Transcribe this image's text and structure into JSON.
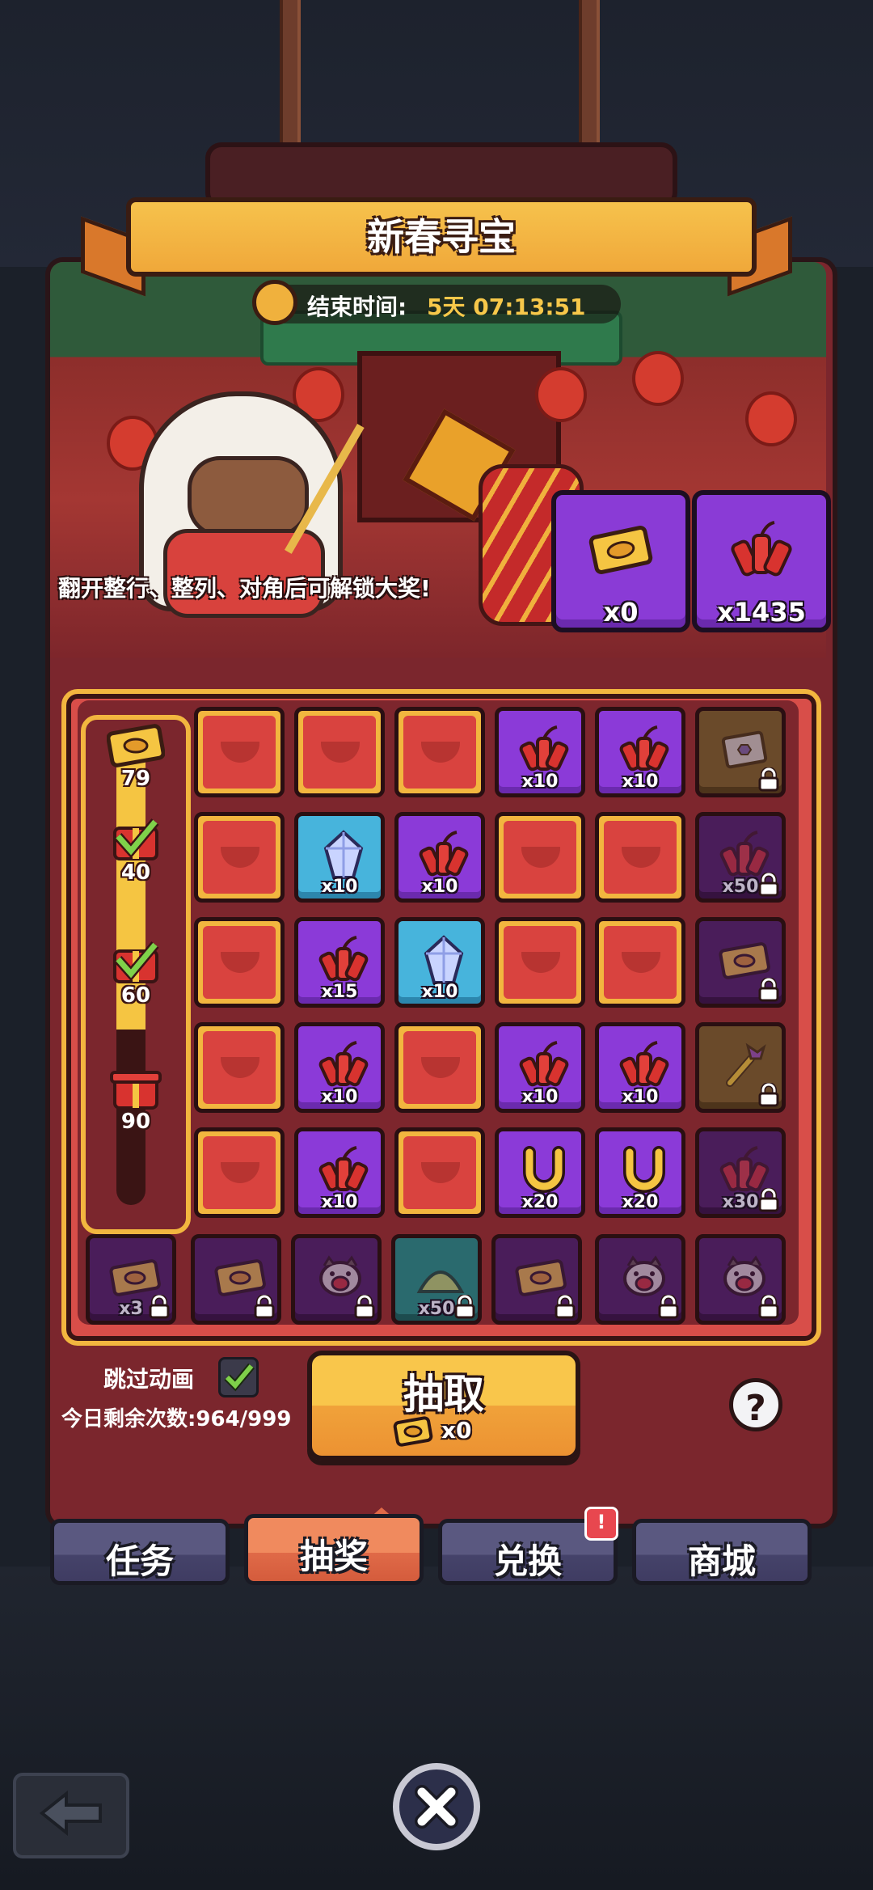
{
  "event": {
    "title": "新春寻宝",
    "timer_label": "结束时间:",
    "timer_value": "5天 07:13:51",
    "hint": "翻开整行、整列、对角后可解锁大奖!"
  },
  "resources": [
    {
      "icon": "ticket-icon",
      "count": "x0"
    },
    {
      "icon": "firecracker-icon",
      "count": "x1435"
    }
  ],
  "progress": {
    "fill_fraction": 0.62,
    "milestones": [
      {
        "value": "79",
        "icon": "ticket-icon",
        "claimed": false
      },
      {
        "value": "40",
        "icon": "gift-icon",
        "claimed": true
      },
      {
        "value": "60",
        "icon": "gift-icon",
        "claimed": true
      },
      {
        "value": "90",
        "icon": "gift-icon",
        "claimed": false
      }
    ]
  },
  "grid": [
    [
      {
        "type": "red",
        "icon": "ingot-icon",
        "qty": ""
      },
      {
        "type": "red",
        "icon": "ingot-icon",
        "qty": ""
      },
      {
        "type": "red",
        "icon": "ingot-icon",
        "qty": ""
      },
      {
        "type": "purple",
        "icon": "firecracker-icon",
        "qty": "x10"
      },
      {
        "type": "purple",
        "icon": "firecracker-icon",
        "qty": "x10"
      },
      {
        "type": "brown",
        "icon": "scroll-icon",
        "qty": "",
        "locked": true
      }
    ],
    [
      {
        "type": "red",
        "icon": "ingot-icon",
        "qty": ""
      },
      {
        "type": "blue",
        "icon": "crystal-icon",
        "qty": "x10"
      },
      {
        "type": "purple",
        "icon": "firecracker-icon",
        "qty": "x10"
      },
      {
        "type": "red",
        "icon": "ingot-icon",
        "qty": ""
      },
      {
        "type": "red",
        "icon": "ingot-icon",
        "qty": ""
      },
      {
        "type": "dark",
        "icon": "firecracker-icon",
        "qty": "x50",
        "locked": true
      }
    ],
    [
      {
        "type": "red",
        "icon": "ingot-icon",
        "qty": ""
      },
      {
        "type": "purple",
        "icon": "firecracker-icon",
        "qty": "x15"
      },
      {
        "type": "blue",
        "icon": "crystal-icon",
        "qty": "x10"
      },
      {
        "type": "red",
        "icon": "ingot-icon",
        "qty": ""
      },
      {
        "type": "red",
        "icon": "ingot-icon",
        "qty": ""
      },
      {
        "type": "dark",
        "icon": "ticket-icon",
        "qty": "",
        "locked": true
      }
    ],
    [
      {
        "type": "red",
        "icon": "ingot-icon",
        "qty": ""
      },
      {
        "type": "purple",
        "icon": "firecracker-icon",
        "qty": "x10"
      },
      {
        "type": "red",
        "icon": "ingot-icon",
        "qty": ""
      },
      {
        "type": "purple",
        "icon": "firecracker-icon",
        "qty": "x10"
      },
      {
        "type": "purple",
        "icon": "firecracker-icon",
        "qty": "x10"
      },
      {
        "type": "brown",
        "icon": "scepter-icon",
        "qty": "",
        "locked": true
      }
    ],
    [
      {
        "type": "red",
        "icon": "ingot-icon",
        "qty": ""
      },
      {
        "type": "purple",
        "icon": "firecracker-icon",
        "qty": "x10"
      },
      {
        "type": "red",
        "icon": "ingot-icon",
        "qty": ""
      },
      {
        "type": "purple",
        "icon": "horseshoe-icon",
        "qty": "x20"
      },
      {
        "type": "purple",
        "icon": "horseshoe-icon",
        "qty": "x20"
      },
      {
        "type": "dark",
        "icon": "firecracker-icon",
        "qty": "x30",
        "locked": true
      }
    ]
  ],
  "bottom_row": [
    {
      "type": "dark",
      "icon": "ticket-icon",
      "qty": "x3",
      "locked": true
    },
    {
      "type": "dark",
      "icon": "ticket-icon",
      "qty": "",
      "locked": true
    },
    {
      "type": "dark",
      "icon": "pet-icon",
      "qty": "",
      "locked": true
    },
    {
      "type": "teal",
      "icon": "sand-icon",
      "qty": "x50",
      "locked": true
    },
    {
      "type": "dark",
      "icon": "ticket-icon",
      "qty": "",
      "locked": true
    },
    {
      "type": "dark",
      "icon": "pet-icon",
      "qty": "",
      "locked": true
    },
    {
      "type": "dark",
      "icon": "pet-icon",
      "qty": "",
      "locked": true
    }
  ],
  "controls": {
    "skip_label": "跳过动画",
    "skip_checked": true,
    "remaining_label": "今日剩余次数:964/999",
    "draw_label": "抽取",
    "draw_cost": "x0",
    "help_label": "?"
  },
  "tabs": [
    {
      "label": "任务",
      "active": false,
      "badge": ""
    },
    {
      "label": "抽奖",
      "active": true,
      "badge": ""
    },
    {
      "label": "兑换",
      "active": false,
      "badge": "!"
    },
    {
      "label": "商城",
      "active": false,
      "badge": ""
    }
  ],
  "colors": {
    "panel": "#7b262d",
    "gold": "#f2b63f",
    "purple": "#8b3ad8",
    "blue": "#47b4dc",
    "active_tab": "#e06a48"
  }
}
